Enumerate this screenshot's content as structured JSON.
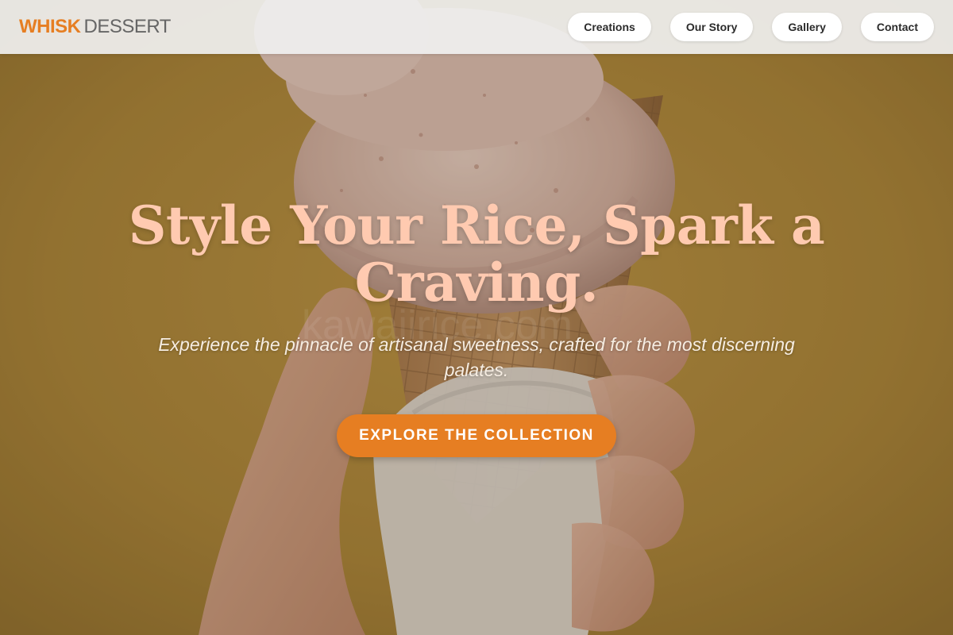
{
  "brand": {
    "primary": "WHISK",
    "secondary": "DESSERT"
  },
  "nav": {
    "items": [
      {
        "label": "Creations"
      },
      {
        "label": "Our Story"
      },
      {
        "label": "Gallery"
      },
      {
        "label": "Contact"
      }
    ]
  },
  "hero": {
    "title": "Style Your Rice, Spark a Craving.",
    "subtitle": "Experience the pinnacle of artisanal sweetness, crafted for the most discerning palates.",
    "cta_label": "EXPLORE THE COLLECTION",
    "background_image": "ice-cream-cone-held-in-hand",
    "watermark": "kawaiirice.com"
  },
  "colors": {
    "accent": "#e67e22",
    "title": "#ffcab0",
    "nav_bar": "#f0f0f0",
    "hero_background": "#b08a3a",
    "subtitle": "#f6ede2"
  }
}
